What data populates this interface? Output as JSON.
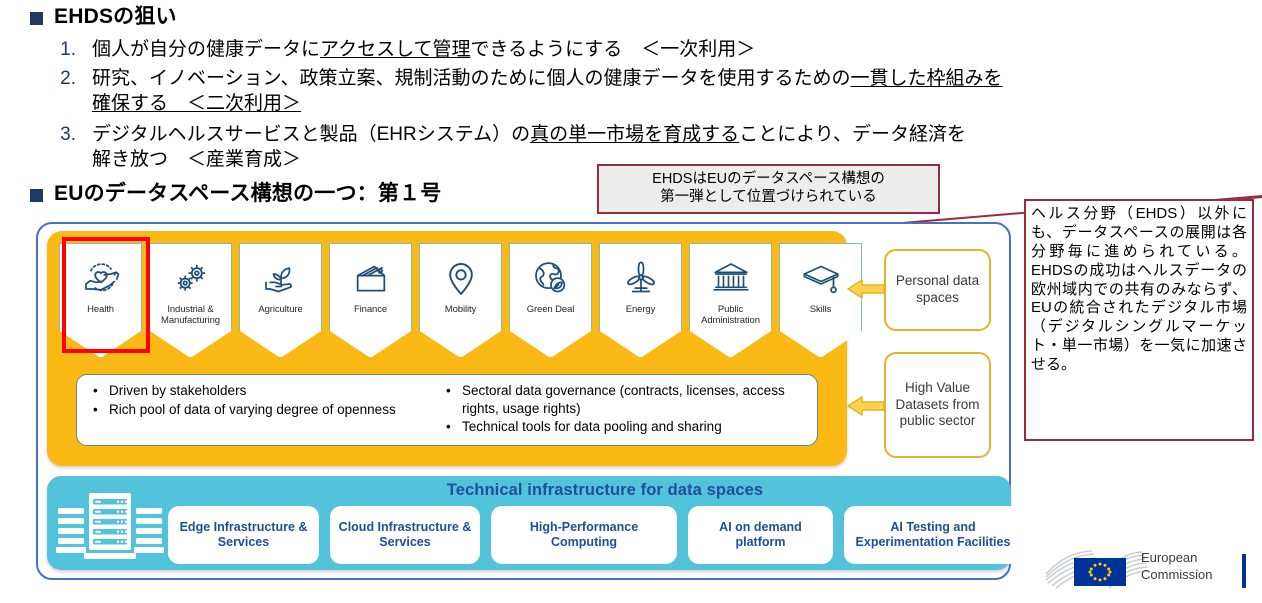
{
  "slide": {
    "sections": [
      {
        "id": "aims",
        "heading": "EHDSの狙い"
      },
      {
        "id": "dataspace",
        "heading": "EUのデータスペース構想の一つ：第１号"
      }
    ],
    "aims_items": [
      {
        "num": "1.",
        "line1_a": "個人が自分の健康データに",
        "line1_u": "アクセスして管理",
        "line1_b": "できるようにする　＜一次利用＞",
        "line2_u": "",
        "line2_b": ""
      },
      {
        "num": "2.",
        "line1_a": "研究、イノベーション、政策立案、規制活動のために個人の健康データを使用するための",
        "line1_u": "一貫した枠組みを",
        "line1_b": "",
        "line2_u": "確保する　＜二次利用＞",
        "line2_b": ""
      },
      {
        "num": "3.",
        "line1_a": "デジタルヘルスサービスと製品（EHRシステム）の",
        "line1_u": "真の単一市場を育成する",
        "line1_b": "ことにより、データ経済を",
        "line2_u": "",
        "line2_b": "解き放つ　＜産業育成＞"
      }
    ]
  },
  "callout": {
    "line1": "EHDSはEUのデータスペース構想の",
    "line2": "第一弾として位置づけられている"
  },
  "annotation": {
    "text": "ヘルス分野（EHDS）以外にも、データスペースの展開は各分野毎に進められている。EHDSの成功はヘルスデータの欧州域内での共有のみならず、EUの統合されたデジタル市場（デジタルシングルマーケット・単一市場）を一気に加速させる。"
  },
  "diagram": {
    "sectors": [
      {
        "label": "Health",
        "icon": "heart-in-hands-icon",
        "highlighted": true
      },
      {
        "label": "Industrial & Manufacturing",
        "icon": "gears-icon",
        "highlighted": false
      },
      {
        "label": "Agriculture",
        "icon": "sprout-in-hand-icon",
        "highlighted": false
      },
      {
        "label": "Finance",
        "icon": "wallet-icon",
        "highlighted": false
      },
      {
        "label": "Mobility",
        "icon": "map-pin-icon",
        "highlighted": false
      },
      {
        "label": "Green Deal",
        "icon": "globe-leaf-icon",
        "highlighted": false
      },
      {
        "label": "Energy",
        "icon": "wind-turbine-icon",
        "highlighted": false
      },
      {
        "label": "Public Administration",
        "icon": "government-building-icon",
        "highlighted": false
      },
      {
        "label": "Skills",
        "icon": "graduation-cap-icon",
        "highlighted": false
      }
    ],
    "strip_left": [
      "Driven by stakeholders",
      "Rich pool of data of varying degree of openness"
    ],
    "strip_right": [
      "Sectoral data governance (contracts, licenses, access rights, usage rights)",
      "Technical tools for data pooling and sharing"
    ],
    "side_boxes": [
      {
        "text": "Personal data spaces"
      },
      {
        "text": "High Value Datasets from public sector"
      }
    ],
    "infrastructure": {
      "title": "Technical infrastructure for data spaces",
      "icon": "server-rack-icon",
      "cards": [
        "Edge Infrastructure & Services",
        "Cloud Infrastructure & Services",
        "High-Performance Computing",
        "AI on demand platform",
        "AI Testing and Experimentation Facilities"
      ]
    }
  },
  "logo": {
    "line1": "European",
    "line2": "Commission"
  },
  "colors": {
    "navy": "#1F3864",
    "dark_red": "#9E2B3D",
    "highlight_red": "#FF0000",
    "yellow_panel": "#FAB914",
    "teal_panel": "#53C3DC",
    "frame_blue": "#4472C4",
    "infra_text_blue": "#1F4E9C",
    "sector_border": "#7FBFA8",
    "sidebox_border": "#E3B32A"
  }
}
